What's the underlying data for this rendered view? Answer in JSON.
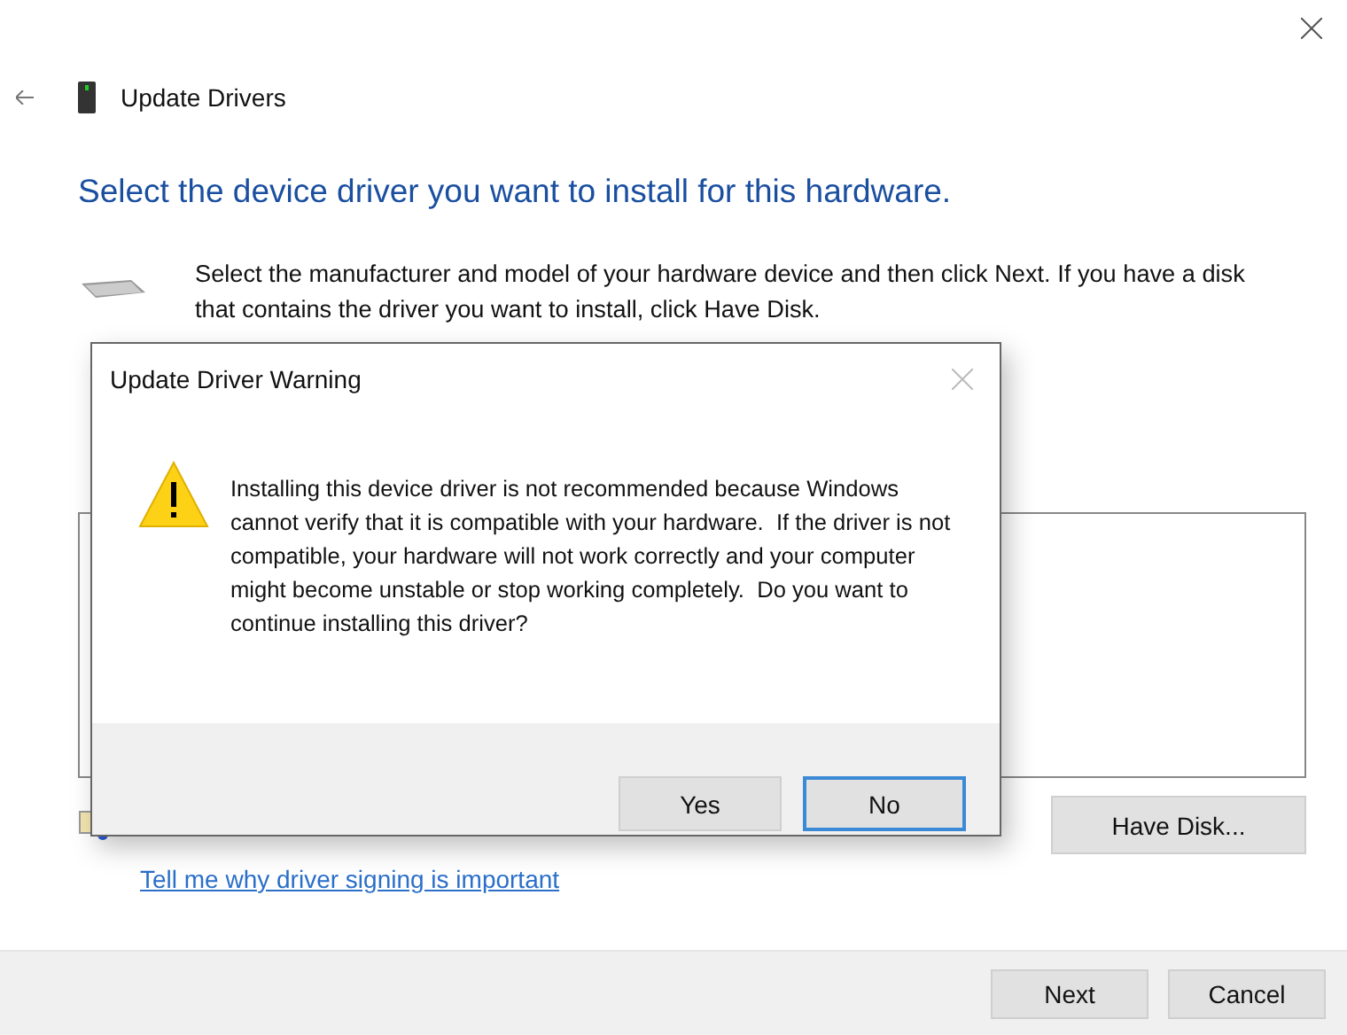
{
  "window": {
    "title": "Update Drivers"
  },
  "heading": "Select the device driver you want to install for this hardware.",
  "description": "Select the manufacturer and model of your hardware device and then click Next. If you have a disk that contains the driver you want to install, click Have Disk.",
  "signing_link": "Tell me why driver signing is important",
  "have_disk_button": "Have Disk...",
  "footer_buttons": [
    {
      "label": "Next"
    },
    {
      "label": "Cancel"
    }
  ],
  "dialog": {
    "title": "Update Driver Warning",
    "message": "Installing this device driver is not recommended because Windows cannot verify that it is compatible with your hardware.  If the driver is not compatible, your hardware will not work correctly and your computer might become unstable or stop working completely.  Do you want to continue installing this driver?",
    "buttons": [
      {
        "label": "Yes",
        "selected": false
      },
      {
        "label": "No",
        "selected": true
      }
    ]
  }
}
